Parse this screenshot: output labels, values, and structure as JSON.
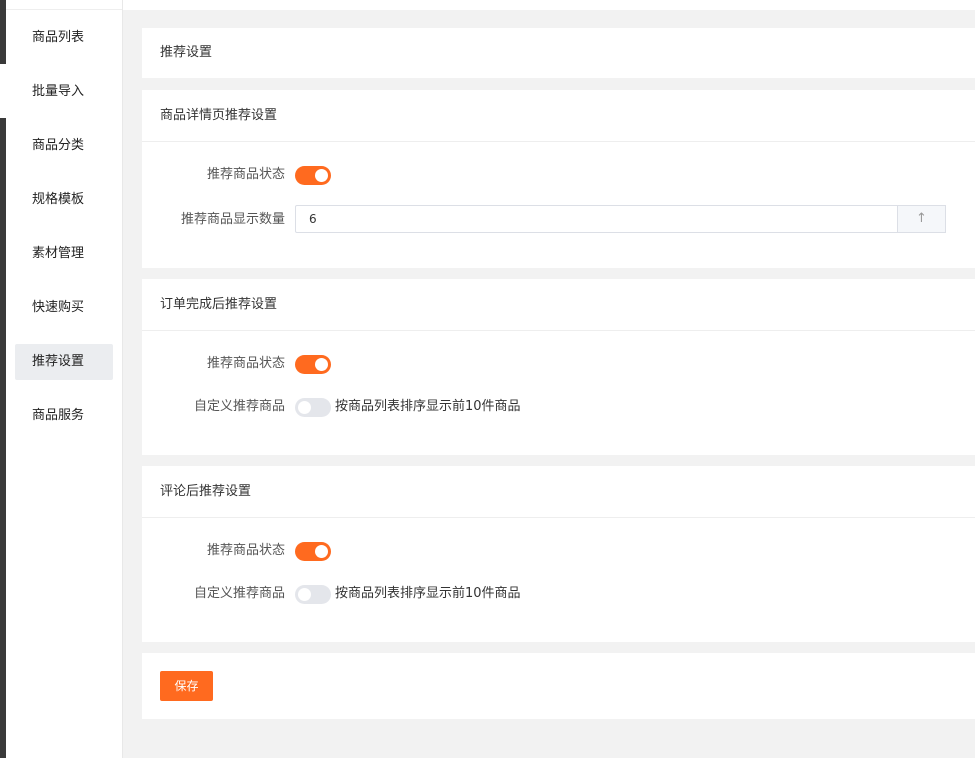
{
  "sidebar": {
    "items": [
      {
        "label": "商品列表"
      },
      {
        "label": "批量导入"
      },
      {
        "label": "商品分类"
      },
      {
        "label": "规格模板"
      },
      {
        "label": "素材管理"
      },
      {
        "label": "快速购买"
      },
      {
        "label": "推荐设置",
        "active": true
      },
      {
        "label": "商品服务"
      }
    ]
  },
  "page": {
    "title": "推荐设置"
  },
  "sections": {
    "detail": {
      "title": "商品详情页推荐设置",
      "status_label": "推荐商品状态",
      "status_on": true,
      "count_label": "推荐商品显示数量",
      "count_value": "6",
      "count_icon": "arrow-up-icon",
      "count_btn_glyph": "↑"
    },
    "order": {
      "title": "订单完成后推荐设置",
      "status_label": "推荐商品状态",
      "status_on": true,
      "custom_label": "自定义推荐商品",
      "custom_on": false,
      "custom_desc": "按商品列表排序显示前10件商品"
    },
    "review": {
      "title": "评论后推荐设置",
      "status_label": "推荐商品状态",
      "status_on": true,
      "custom_label": "自定义推荐商品",
      "custom_on": false,
      "custom_desc": "按商品列表排序显示前10件商品"
    }
  },
  "actions": {
    "save_label": "保存"
  },
  "colors": {
    "accent": "#ff6a1f",
    "switch_off": "#e4e6eb",
    "page_bg": "#f2f2f2",
    "sidebar_active_bg": "#ebedf0"
  }
}
